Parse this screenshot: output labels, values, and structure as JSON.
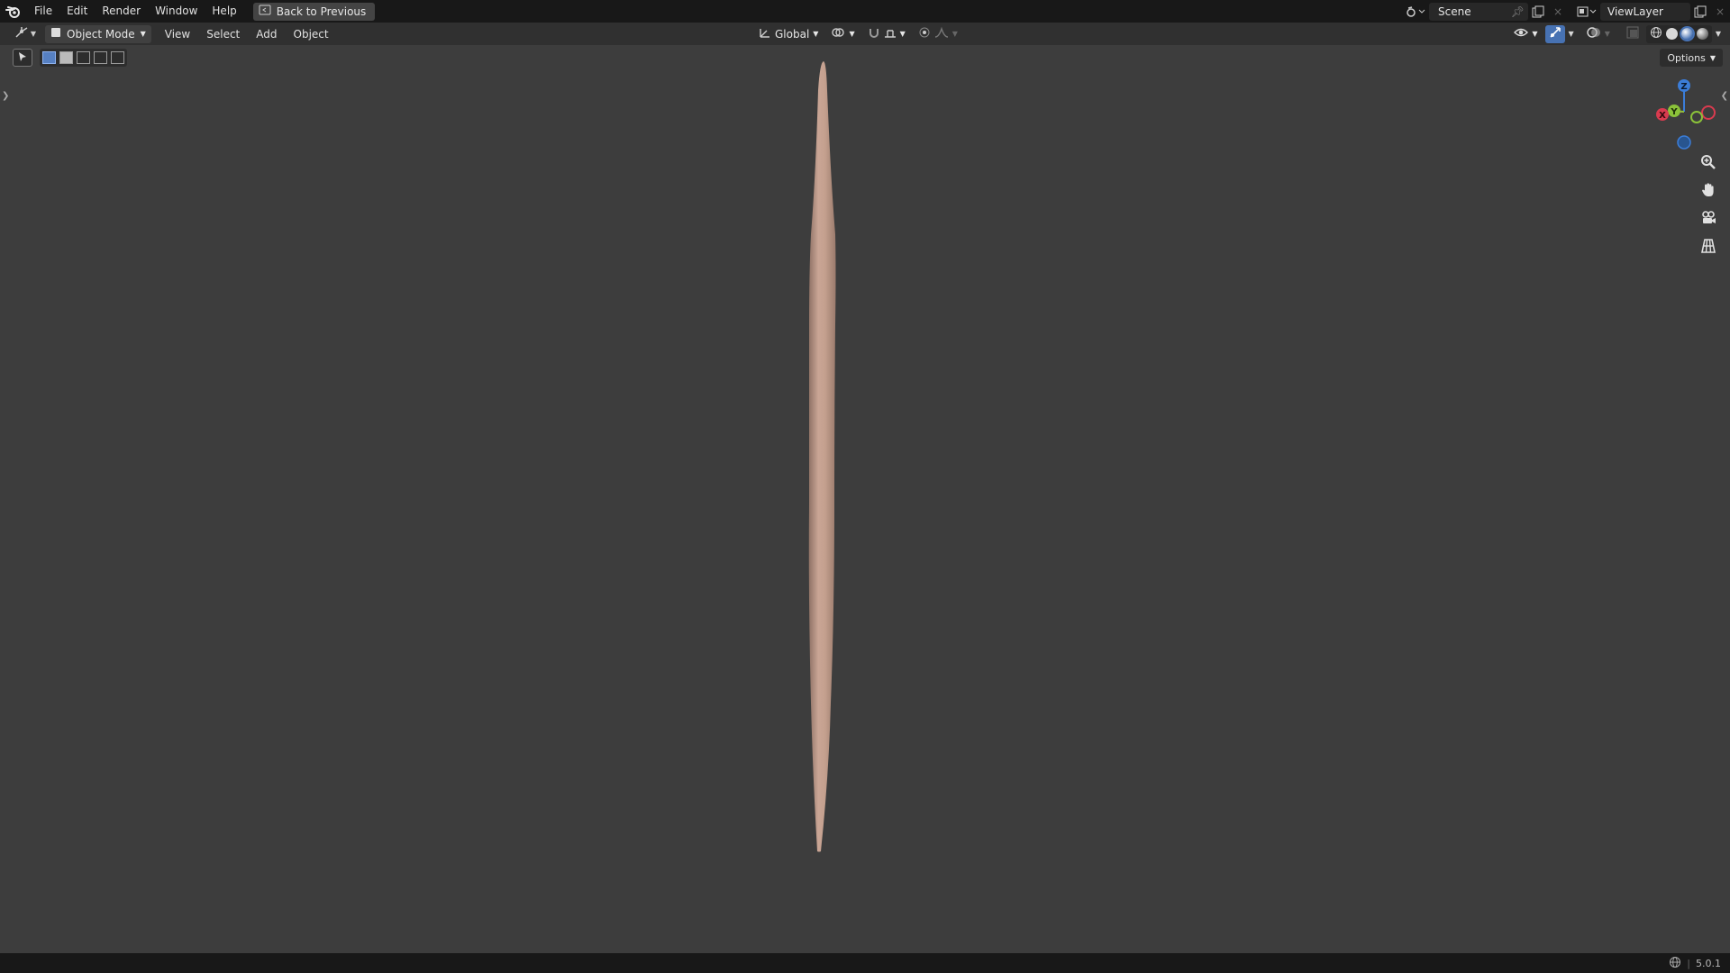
{
  "topbar": {
    "menus": [
      "File",
      "Edit",
      "Render",
      "Window",
      "Help"
    ],
    "back_button": "Back to Previous",
    "scene": "Scene",
    "view_layer": "ViewLayer"
  },
  "header": {
    "mode": "Object Mode",
    "menus": [
      "View",
      "Select",
      "Add",
      "Object"
    ],
    "transform_orientation": "Global"
  },
  "viewport": {
    "options": "Options",
    "gizmo_axes": {
      "z": "Z",
      "y": "Y",
      "x": "X"
    },
    "object_color": "#c4a08e",
    "background_color": "#3d3d3d"
  },
  "statusbar": {
    "version": "5.0.1"
  }
}
